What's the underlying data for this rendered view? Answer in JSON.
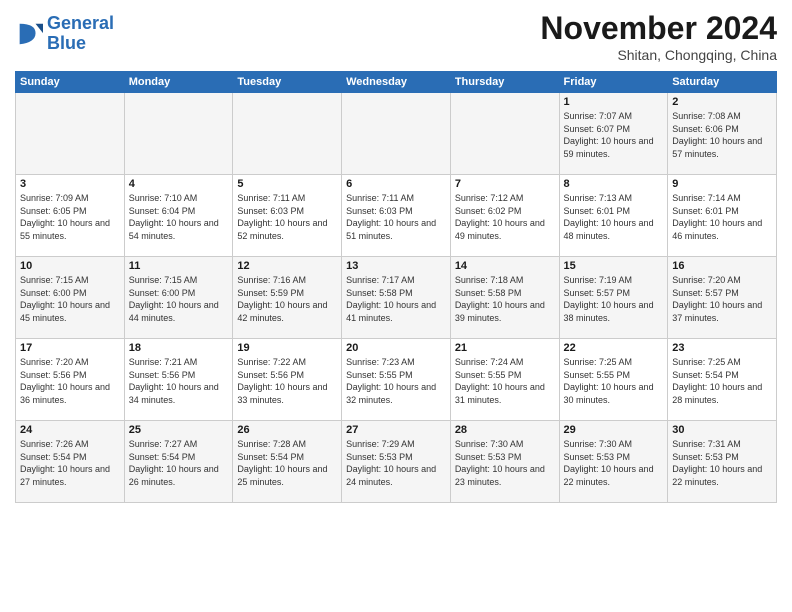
{
  "header": {
    "logo_line1": "General",
    "logo_line2": "Blue",
    "month": "November 2024",
    "location": "Shitan, Chongqing, China"
  },
  "days_of_week": [
    "Sunday",
    "Monday",
    "Tuesday",
    "Wednesday",
    "Thursday",
    "Friday",
    "Saturday"
  ],
  "weeks": [
    [
      {
        "day": "",
        "info": ""
      },
      {
        "day": "",
        "info": ""
      },
      {
        "day": "",
        "info": ""
      },
      {
        "day": "",
        "info": ""
      },
      {
        "day": "",
        "info": ""
      },
      {
        "day": "1",
        "info": "Sunrise: 7:07 AM\nSunset: 6:07 PM\nDaylight: 10 hours and 59 minutes."
      },
      {
        "day": "2",
        "info": "Sunrise: 7:08 AM\nSunset: 6:06 PM\nDaylight: 10 hours and 57 minutes."
      }
    ],
    [
      {
        "day": "3",
        "info": "Sunrise: 7:09 AM\nSunset: 6:05 PM\nDaylight: 10 hours and 55 minutes."
      },
      {
        "day": "4",
        "info": "Sunrise: 7:10 AM\nSunset: 6:04 PM\nDaylight: 10 hours and 54 minutes."
      },
      {
        "day": "5",
        "info": "Sunrise: 7:11 AM\nSunset: 6:03 PM\nDaylight: 10 hours and 52 minutes."
      },
      {
        "day": "6",
        "info": "Sunrise: 7:11 AM\nSunset: 6:03 PM\nDaylight: 10 hours and 51 minutes."
      },
      {
        "day": "7",
        "info": "Sunrise: 7:12 AM\nSunset: 6:02 PM\nDaylight: 10 hours and 49 minutes."
      },
      {
        "day": "8",
        "info": "Sunrise: 7:13 AM\nSunset: 6:01 PM\nDaylight: 10 hours and 48 minutes."
      },
      {
        "day": "9",
        "info": "Sunrise: 7:14 AM\nSunset: 6:01 PM\nDaylight: 10 hours and 46 minutes."
      }
    ],
    [
      {
        "day": "10",
        "info": "Sunrise: 7:15 AM\nSunset: 6:00 PM\nDaylight: 10 hours and 45 minutes."
      },
      {
        "day": "11",
        "info": "Sunrise: 7:15 AM\nSunset: 6:00 PM\nDaylight: 10 hours and 44 minutes."
      },
      {
        "day": "12",
        "info": "Sunrise: 7:16 AM\nSunset: 5:59 PM\nDaylight: 10 hours and 42 minutes."
      },
      {
        "day": "13",
        "info": "Sunrise: 7:17 AM\nSunset: 5:58 PM\nDaylight: 10 hours and 41 minutes."
      },
      {
        "day": "14",
        "info": "Sunrise: 7:18 AM\nSunset: 5:58 PM\nDaylight: 10 hours and 39 minutes."
      },
      {
        "day": "15",
        "info": "Sunrise: 7:19 AM\nSunset: 5:57 PM\nDaylight: 10 hours and 38 minutes."
      },
      {
        "day": "16",
        "info": "Sunrise: 7:20 AM\nSunset: 5:57 PM\nDaylight: 10 hours and 37 minutes."
      }
    ],
    [
      {
        "day": "17",
        "info": "Sunrise: 7:20 AM\nSunset: 5:56 PM\nDaylight: 10 hours and 36 minutes."
      },
      {
        "day": "18",
        "info": "Sunrise: 7:21 AM\nSunset: 5:56 PM\nDaylight: 10 hours and 34 minutes."
      },
      {
        "day": "19",
        "info": "Sunrise: 7:22 AM\nSunset: 5:56 PM\nDaylight: 10 hours and 33 minutes."
      },
      {
        "day": "20",
        "info": "Sunrise: 7:23 AM\nSunset: 5:55 PM\nDaylight: 10 hours and 32 minutes."
      },
      {
        "day": "21",
        "info": "Sunrise: 7:24 AM\nSunset: 5:55 PM\nDaylight: 10 hours and 31 minutes."
      },
      {
        "day": "22",
        "info": "Sunrise: 7:25 AM\nSunset: 5:55 PM\nDaylight: 10 hours and 30 minutes."
      },
      {
        "day": "23",
        "info": "Sunrise: 7:25 AM\nSunset: 5:54 PM\nDaylight: 10 hours and 28 minutes."
      }
    ],
    [
      {
        "day": "24",
        "info": "Sunrise: 7:26 AM\nSunset: 5:54 PM\nDaylight: 10 hours and 27 minutes."
      },
      {
        "day": "25",
        "info": "Sunrise: 7:27 AM\nSunset: 5:54 PM\nDaylight: 10 hours and 26 minutes."
      },
      {
        "day": "26",
        "info": "Sunrise: 7:28 AM\nSunset: 5:54 PM\nDaylight: 10 hours and 25 minutes."
      },
      {
        "day": "27",
        "info": "Sunrise: 7:29 AM\nSunset: 5:53 PM\nDaylight: 10 hours and 24 minutes."
      },
      {
        "day": "28",
        "info": "Sunrise: 7:30 AM\nSunset: 5:53 PM\nDaylight: 10 hours and 23 minutes."
      },
      {
        "day": "29",
        "info": "Sunrise: 7:30 AM\nSunset: 5:53 PM\nDaylight: 10 hours and 22 minutes."
      },
      {
        "day": "30",
        "info": "Sunrise: 7:31 AM\nSunset: 5:53 PM\nDaylight: 10 hours and 22 minutes."
      }
    ]
  ]
}
